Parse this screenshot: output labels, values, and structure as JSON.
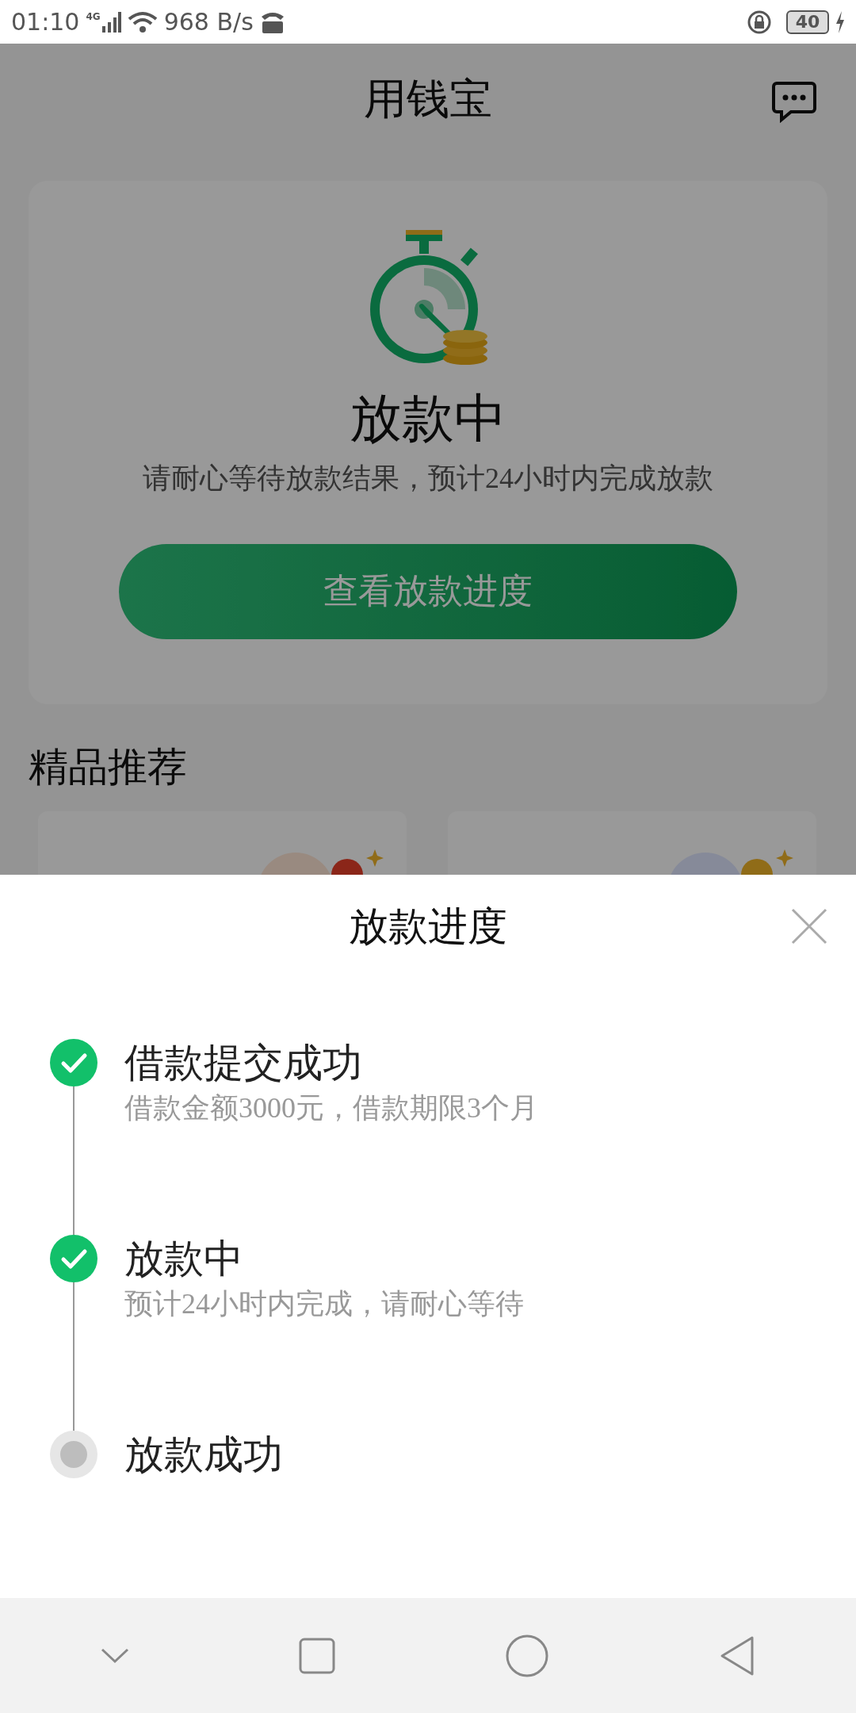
{
  "status_bar": {
    "time": "01:10",
    "network": "4G",
    "speed": "968 B/s",
    "battery": "40"
  },
  "header": {
    "title": "用钱宝"
  },
  "status_card": {
    "title": "放款中",
    "message": "请耐心等待放款结果，预计24小时内完成放款",
    "button": "查看放款进度"
  },
  "recommend": {
    "title": "精品推荐"
  },
  "sheet": {
    "title": "放款进度",
    "steps": [
      {
        "title": "借款提交成功",
        "subtitle": "借款金额3000元，借款期限3个月",
        "done": true
      },
      {
        "title": "放款中",
        "subtitle": "预计24小时内完成，请耐心等待",
        "done": true
      },
      {
        "title": "放款成功",
        "done": false
      }
    ]
  }
}
